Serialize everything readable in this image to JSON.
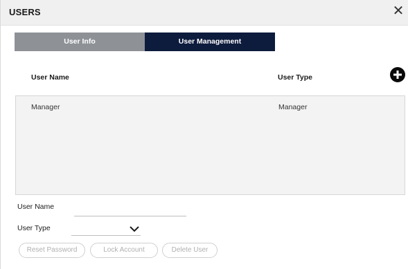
{
  "dialog": {
    "title": "USERS",
    "close_icon": "close-icon"
  },
  "tabs": [
    {
      "label": "User Info",
      "active": false,
      "color": "#8e9297"
    },
    {
      "label": "User Management",
      "active": true,
      "color": "#0d1b3d"
    }
  ],
  "table": {
    "headers": {
      "name": "User Name",
      "type": "User Type"
    },
    "add_icon": "plus-circle-icon",
    "rows": [
      {
        "name": "Manager",
        "type": "Manager"
      }
    ]
  },
  "form": {
    "user_name_label": "User Name",
    "user_name_value": "",
    "user_type_label": "User Type",
    "user_type_value": "",
    "chevron_icon": "chevron-down-icon"
  },
  "actions": {
    "reset_password": "Reset Password",
    "lock_account": "Lock Account",
    "delete_user": "Delete User"
  }
}
